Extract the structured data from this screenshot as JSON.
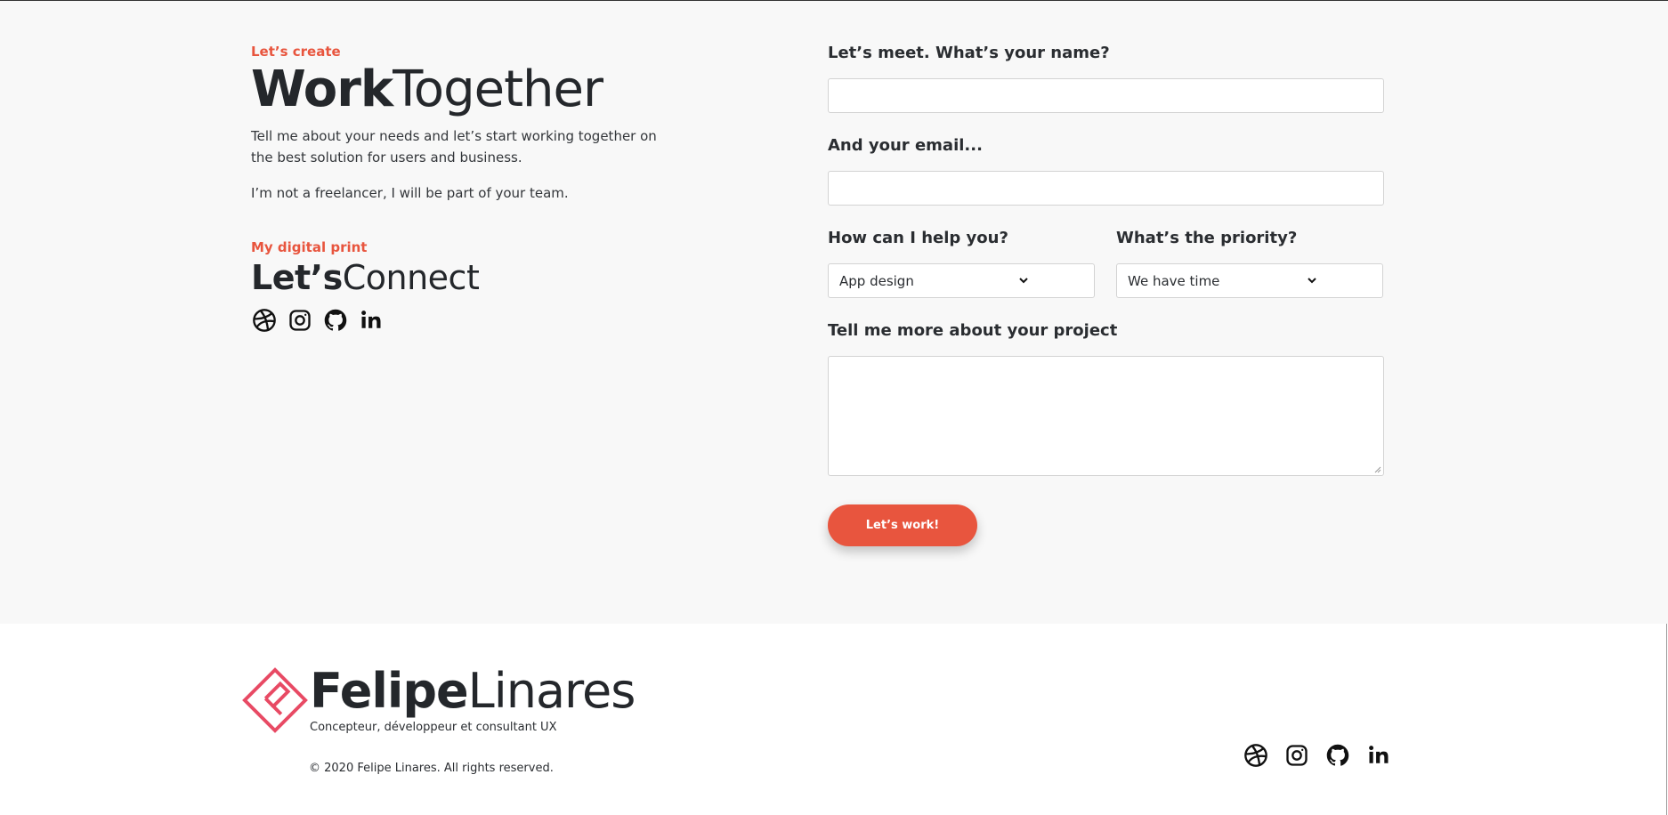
{
  "contact": {
    "eyebrow": "Let’s create",
    "title_bold": "Work",
    "title_light": "Together",
    "intro": "Tell me about your needs and let’s start working together on the best solution for users and business.",
    "note": "I’m not a freelancer, I will be part of your team.",
    "connect_eyebrow": "My digital print",
    "connect_bold": "Let’s",
    "connect_light": "Connect",
    "socials": [
      "dribbble-icon",
      "instagram-icon",
      "github-icon",
      "linkedin-icon"
    ]
  },
  "form": {
    "name_label": "Let’s meet. What’s your name?",
    "name_value": "",
    "email_label": "And your email...",
    "email_value": "",
    "help_label": "How can I help you?",
    "help_selected": "App design",
    "priority_label": "What’s the priority?",
    "priority_selected": "We have time",
    "project_label": "Tell me more about your project",
    "project_value": "",
    "submit_label": "Let’s work!"
  },
  "footer": {
    "name_bold": "Felipe",
    "name_light": "Linares",
    "tagline": "Concepteur, développeur et consultant UX",
    "copyright": "© 2020 Felipe Linares. All rights reserved.",
    "socials": [
      "dribbble-icon",
      "instagram-icon",
      "github-icon",
      "linkedin-icon"
    ]
  },
  "colors": {
    "accent": "#e8553e",
    "logo": "#e84a64",
    "text": "#24272b",
    "section_bg": "#f8f8f8"
  }
}
